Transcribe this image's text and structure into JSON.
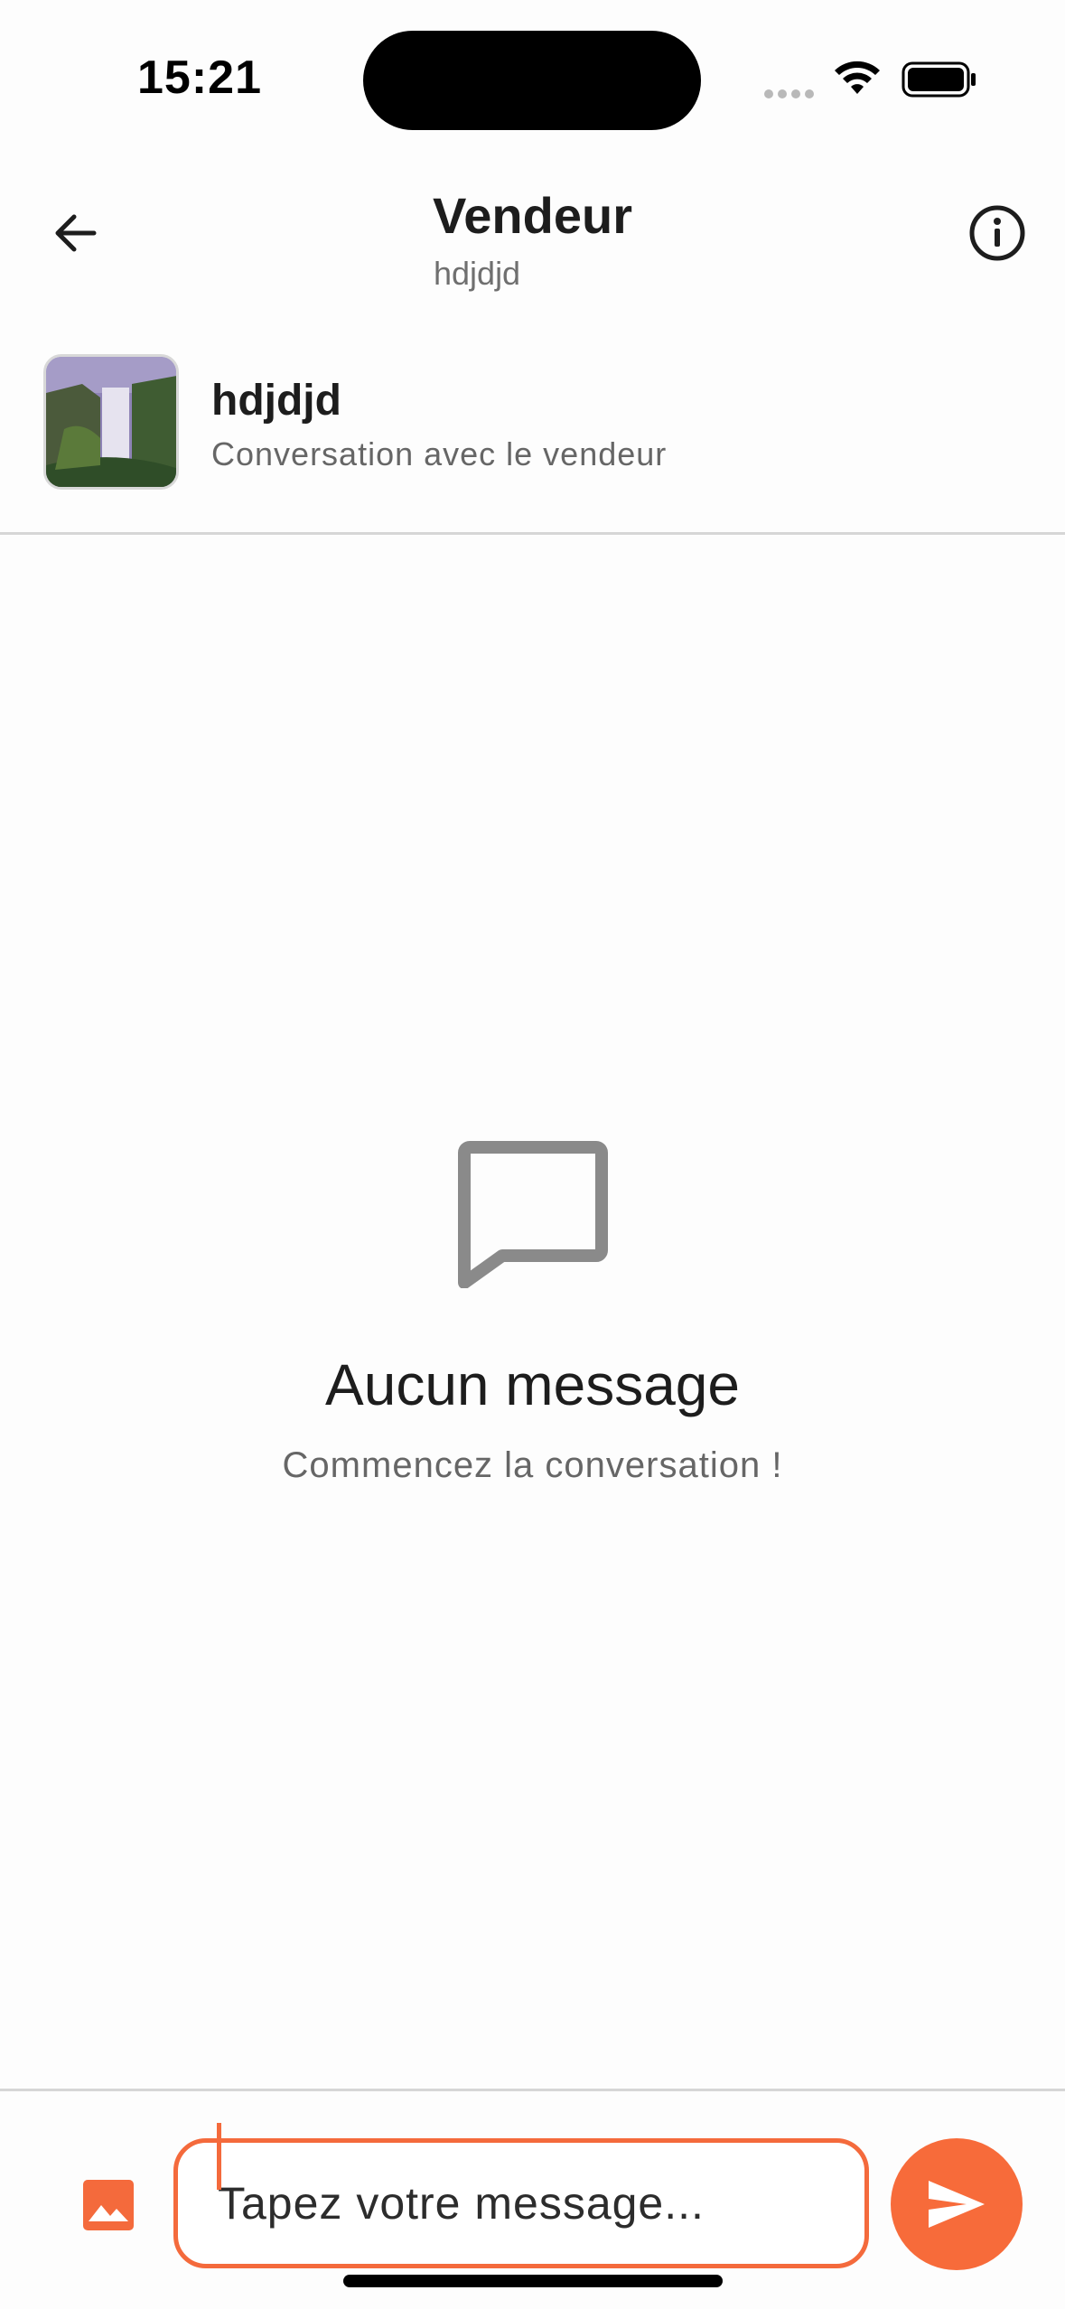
{
  "status_bar": {
    "time": "15:21"
  },
  "header": {
    "title": "Vendeur",
    "subtitle": "hdjdjd"
  },
  "seller": {
    "name": "hdjdjd",
    "description": "Conversation avec le vendeur"
  },
  "empty_state": {
    "title": "Aucun message",
    "subtitle": "Commencez la conversation !"
  },
  "composer": {
    "placeholder": "Tapez votre message..."
  },
  "colors": {
    "accent": "#f76b3a",
    "text": "#1d1d1d",
    "muted": "#666666",
    "divider": "#d6d6d6"
  },
  "icons": [
    "back-arrow-icon",
    "info-icon",
    "chat-bubble-icon",
    "image-icon",
    "send-icon",
    "wifi-icon",
    "battery-icon"
  ]
}
